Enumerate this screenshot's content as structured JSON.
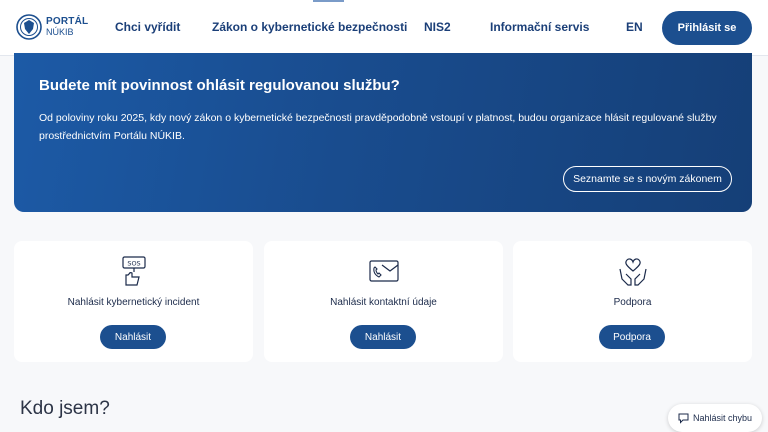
{
  "header": {
    "logo_top": "PORTÁL",
    "logo_bottom": "NÚKIB",
    "nav": [
      "Chci vyřídit",
      "Zákon o kybernetické bezpečnosti",
      "NIS2",
      "Informační servis"
    ],
    "lang": "EN",
    "login_label": "Přihlásit se"
  },
  "hero": {
    "title": "Budete mít povinnost ohlásit regulovanou službu?",
    "text": "Od poloviny roku 2025, kdy nový zákon o kybernetické bezpečnosti pravděpodobně vstoupí v platnost, budou organizace hlásit regulované služby prostřednictvím Portálu NÚKIB.",
    "button": "Seznamte se s novým zákonem"
  },
  "cards": [
    {
      "icon": "sos-alert-icon",
      "label": "Nahlásit kybernetický incident",
      "button": "Nahlásit"
    },
    {
      "icon": "phone-mail-icon",
      "label": "Nahlásit kontaktní údaje",
      "button": "Nahlásit"
    },
    {
      "icon": "heart-hands-icon",
      "label": "Podpora",
      "button": "Podpora"
    }
  ],
  "section_title": "Kdo jsem?",
  "report_button": "Nahlásit chybu",
  "colors": {
    "primary": "#1c4f8f",
    "hero_gradient_start": "#1c5aa6",
    "hero_gradient_end": "#153f77",
    "background": "#f7f8fa"
  }
}
